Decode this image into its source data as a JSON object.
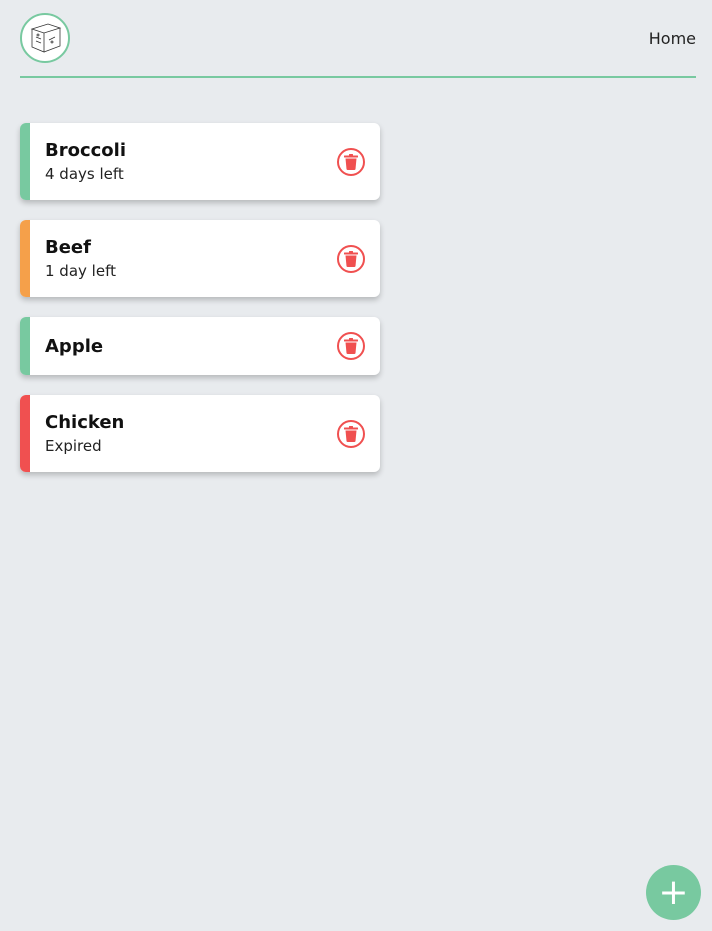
{
  "header": {
    "nav_home": "Home",
    "logo_icon": "fridge-box-logo"
  },
  "items": [
    {
      "name": "Broccoli",
      "status": "4 days left",
      "status_color": "#78c9a0"
    },
    {
      "name": "Beef",
      "status": "1 day left",
      "status_color": "#f5a04a"
    },
    {
      "name": "Apple",
      "status": "",
      "status_color": "#78c9a0"
    },
    {
      "name": "Chicken",
      "status": "Expired",
      "status_color": "#f05050"
    }
  ],
  "delete_icon": "trash-icon",
  "add_button": {
    "label": "+",
    "icon": "plus-icon"
  },
  "colors": {
    "accent": "#78c9a0",
    "warning": "#f5a04a",
    "danger": "#f05050",
    "background": "#e8ebee"
  }
}
